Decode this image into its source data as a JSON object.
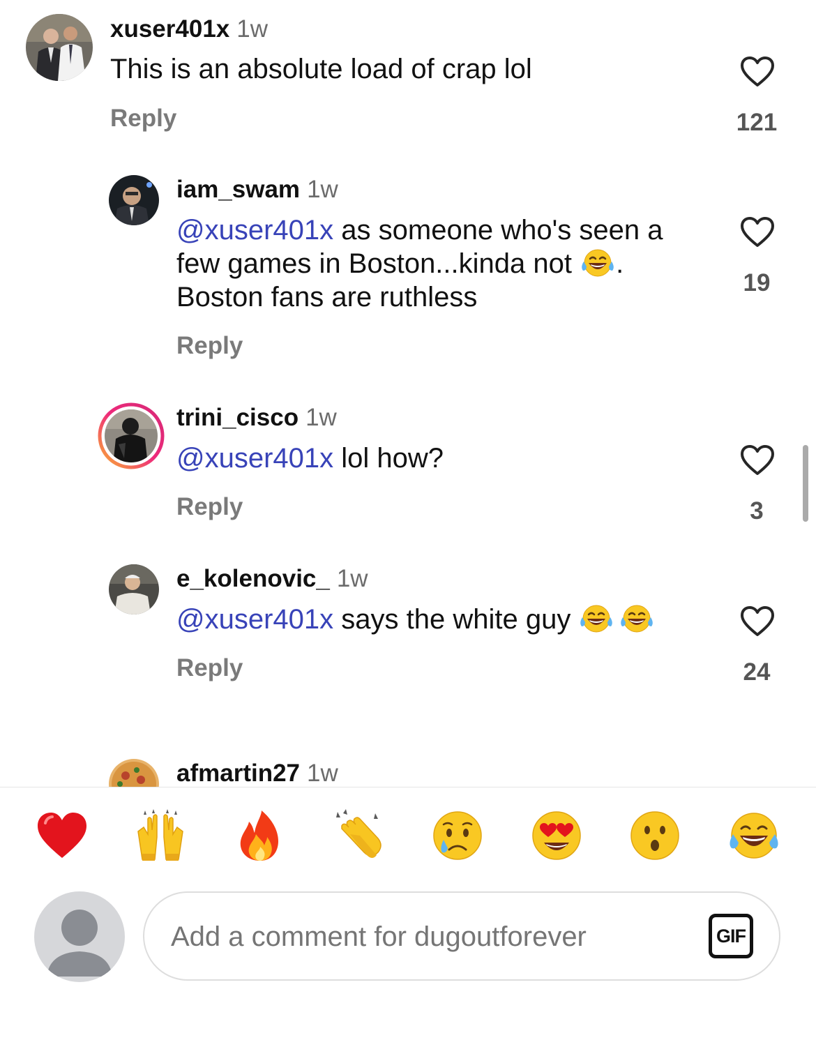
{
  "comments": [
    {
      "username": "xuser401x",
      "time": "1w",
      "text": "This is an absolute load of crap lol",
      "reply": "Reply",
      "likes": "121"
    },
    {
      "username": "iam_swam",
      "time": "1w",
      "mention": "@xuser401x",
      "text_line1": " as someone who's seen a",
      "text_line2_before": "few games in Boston...kinda not ",
      "text_line2_after": ".",
      "text_line3": "Boston fans are ruthless",
      "emoji": "face-with-tears-of-joy-icon",
      "reply": "Reply",
      "likes": "19"
    },
    {
      "username": "trini_cisco",
      "time": "1w",
      "mention": "@xuser401x",
      "text": " lol how?",
      "story_ring": true,
      "reply": "Reply",
      "likes": "3"
    },
    {
      "username": "e_kolenovic_",
      "time": "1w",
      "mention": "@xuser401x",
      "text": " says the white guy ",
      "emojis": [
        "face-with-tears-of-joy-icon",
        "face-with-tears-of-joy-icon"
      ],
      "reply": "Reply",
      "likes": "24"
    },
    {
      "username": "afmartin27",
      "time": "1w"
    }
  ],
  "reactions": [
    "red-heart-icon",
    "raising-hands-icon",
    "fire-icon",
    "clapping-hands-icon",
    "crying-face-icon",
    "heart-eyes-icon",
    "surprised-face-icon",
    "tears-of-joy-icon"
  ],
  "comment_input": {
    "placeholder": "Add a comment for dugoutforever",
    "value": ""
  },
  "gif_label": "GIF",
  "colors": {
    "mention": "#3843b8",
    "muted_text": "#7a7a7a",
    "story_ring_start": "#f9b233",
    "story_ring_end": "#d62976"
  }
}
